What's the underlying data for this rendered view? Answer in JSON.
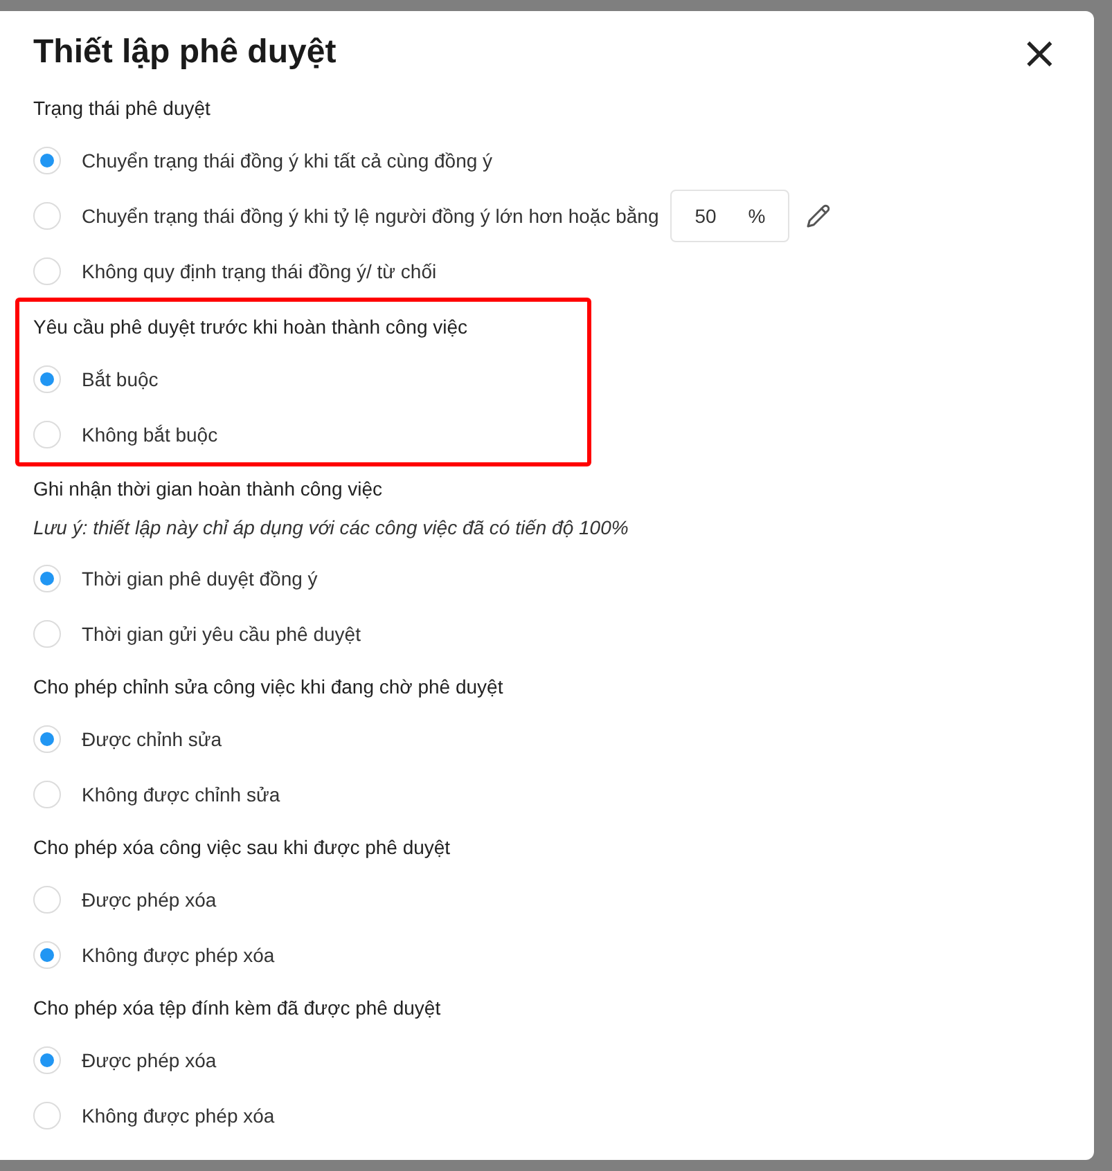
{
  "dialog": {
    "title": "Thiết lập phê duyệt",
    "close_label": "×"
  },
  "sections": [
    {
      "title": "Trạng thái phê duyệt",
      "highlighted": false,
      "options": [
        {
          "kind": "plain",
          "label": "Chuyển trạng thái đồng ý khi tất cả cùng đồng ý",
          "selected": true
        },
        {
          "kind": "percent",
          "label": "Chuyển trạng thái đồng ý khi tỷ lệ người đồng ý lớn hơn hoặc bằng",
          "value": "50",
          "unit": "%",
          "selected": false
        },
        {
          "kind": "plain",
          "label": "Không quy định trạng thái đồng ý/ từ chối",
          "selected": false
        }
      ]
    },
    {
      "title": "Yêu cầu phê duyệt trước khi hoàn thành công việc",
      "highlighted": true,
      "options": [
        {
          "kind": "plain",
          "label": "Bắt buộc",
          "selected": true
        },
        {
          "kind": "plain",
          "label": "Không bắt buộc",
          "selected": false
        }
      ]
    },
    {
      "title": "Ghi nhận thời gian hoàn thành công việc",
      "note": "Lưu ý: thiết lập này chỉ áp dụng với các công việc đã có tiến độ 100%",
      "highlighted": false,
      "options": [
        {
          "kind": "plain",
          "label": "Thời gian phê duyệt đồng ý",
          "selected": true
        },
        {
          "kind": "plain",
          "label": "Thời gian gửi yêu cầu phê duyệt",
          "selected": false
        }
      ]
    },
    {
      "title": "Cho phép chỉnh sửa công việc khi đang chờ phê duyệt",
      "highlighted": false,
      "options": [
        {
          "kind": "plain",
          "label": "Được chỉnh sửa",
          "selected": true
        },
        {
          "kind": "plain",
          "label": "Không được chỉnh sửa",
          "selected": false
        }
      ]
    },
    {
      "title": "Cho phép xóa công việc sau khi được phê duyệt",
      "highlighted": false,
      "options": [
        {
          "kind": "plain",
          "label": "Được phép xóa",
          "selected": false
        },
        {
          "kind": "plain",
          "label": "Không được phép xóa",
          "selected": true
        }
      ]
    },
    {
      "title": "Cho phép xóa tệp đính kèm đã được phê duyệt",
      "highlighted": false,
      "options": [
        {
          "kind": "plain",
          "label": "Được phép xóa",
          "selected": true
        },
        {
          "kind": "plain",
          "label": "Không được phép xóa",
          "selected": false
        }
      ]
    }
  ]
}
